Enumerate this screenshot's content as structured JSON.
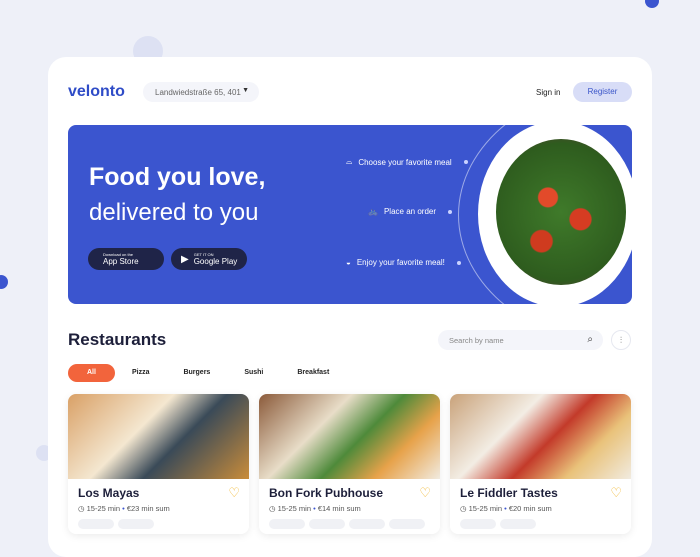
{
  "header": {
    "logo": "velonto",
    "address": "Landwiedstraße 65, 401",
    "sign_in": "Sign in",
    "register": "Register"
  },
  "hero": {
    "title_line1": "Food you love,",
    "title_line2": "delivered to you",
    "app_store": {
      "small": "Download on the",
      "label": "App Store"
    },
    "google_play": {
      "small": "GET IT ON",
      "label": "Google Play"
    },
    "steps": [
      {
        "label": "Choose your favorite meal",
        "icon": "cloche-icon"
      },
      {
        "label": "Place an order",
        "icon": "delivery-bike-icon"
      },
      {
        "label": "Enjoy your favorite meal!",
        "icon": "food-box-icon"
      }
    ]
  },
  "restaurants": {
    "title": "Restaurants",
    "search_placeholder": "Search by name",
    "categories": [
      "All",
      "Pizza",
      "Burgers",
      "Sushi",
      "Breakfast"
    ],
    "active_category": "All",
    "items": [
      {
        "name": "Los Mayas",
        "time": "15-25 min",
        "min_sum": "€23 min sum"
      },
      {
        "name": "Bon Fork Pubhouse",
        "time": "15-25 min",
        "min_sum": "€14 min sum"
      },
      {
        "name": "Le Fiddler Tastes",
        "time": "15-25 min",
        "min_sum": "€20 min sum"
      }
    ]
  },
  "colors": {
    "brand": "#2f4cc7",
    "hero": "#3b55cf",
    "accent": "#f2643c",
    "heart": "#f0b429"
  }
}
